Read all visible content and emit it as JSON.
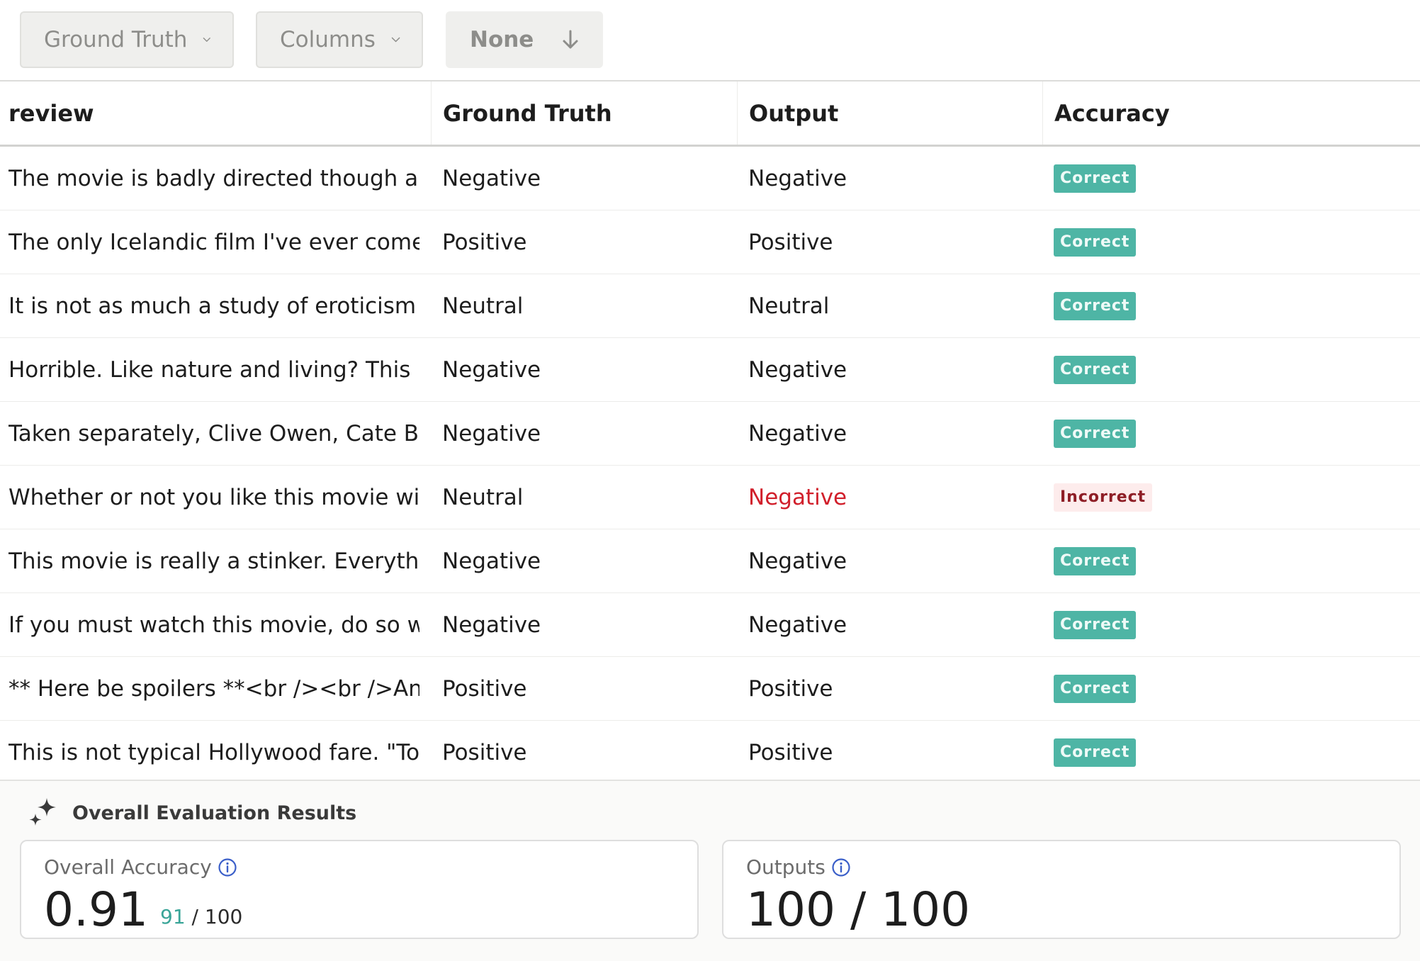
{
  "toolbar": {
    "filter_label": "Ground Truth",
    "columns_label": "Columns",
    "sort_label": "None"
  },
  "table": {
    "headers": [
      "review",
      "Ground Truth",
      "Output",
      "Accuracy"
    ],
    "rows": [
      {
        "review": "The movie is badly directed though a g...",
        "ground_truth": "Negative",
        "output": "Negative",
        "accuracy": "Correct"
      },
      {
        "review": "The only Icelandic film I've ever come a...",
        "ground_truth": "Positive",
        "output": "Positive",
        "accuracy": "Correct"
      },
      {
        "review": "It is not as much a study of eroticism a...",
        "ground_truth": "Neutral",
        "output": "Neutral",
        "accuracy": "Correct"
      },
      {
        "review": "Horrible. Like nature and living? This is ...",
        "ground_truth": "Negative",
        "output": "Negative",
        "accuracy": "Correct"
      },
      {
        "review": "Taken separately, Clive Owen, Cate Bla...",
        "ground_truth": "Negative",
        "output": "Negative",
        "accuracy": "Correct"
      },
      {
        "review": "Whether or not you like this movie will ...",
        "ground_truth": "Neutral",
        "output": "Negative",
        "accuracy": "Incorrect"
      },
      {
        "review": "This movie is really a stinker. Everythin...",
        "ground_truth": "Negative",
        "output": "Negative",
        "accuracy": "Correct"
      },
      {
        "review": "If you must watch this movie, do so wit...",
        "ground_truth": "Negative",
        "output": "Negative",
        "accuracy": "Correct"
      },
      {
        "review": "** Here be spoilers **<br /><br />An a...",
        "ground_truth": "Positive",
        "output": "Positive",
        "accuracy": "Correct"
      },
      {
        "review": "This is not typical Hollywood fare. \"To ...",
        "ground_truth": "Positive",
        "output": "Positive",
        "accuracy": "Correct"
      }
    ]
  },
  "summary": {
    "title": "Overall Evaluation Results",
    "accuracy_card": {
      "label": "Overall Accuracy",
      "value": "0.91",
      "correct": "91",
      "total": "/ 100"
    },
    "outputs_card": {
      "label": "Outputs",
      "value": "100 / 100"
    }
  },
  "colors": {
    "correct_badge": "#4eb5a5",
    "incorrect_badge_bg": "#fdecec",
    "incorrect_text": "#d11f2b",
    "info_icon": "#3b5fc9"
  },
  "icons": [
    "chevron-down-icon",
    "arrow-down-icon",
    "sparkle-icon",
    "info-icon"
  ]
}
